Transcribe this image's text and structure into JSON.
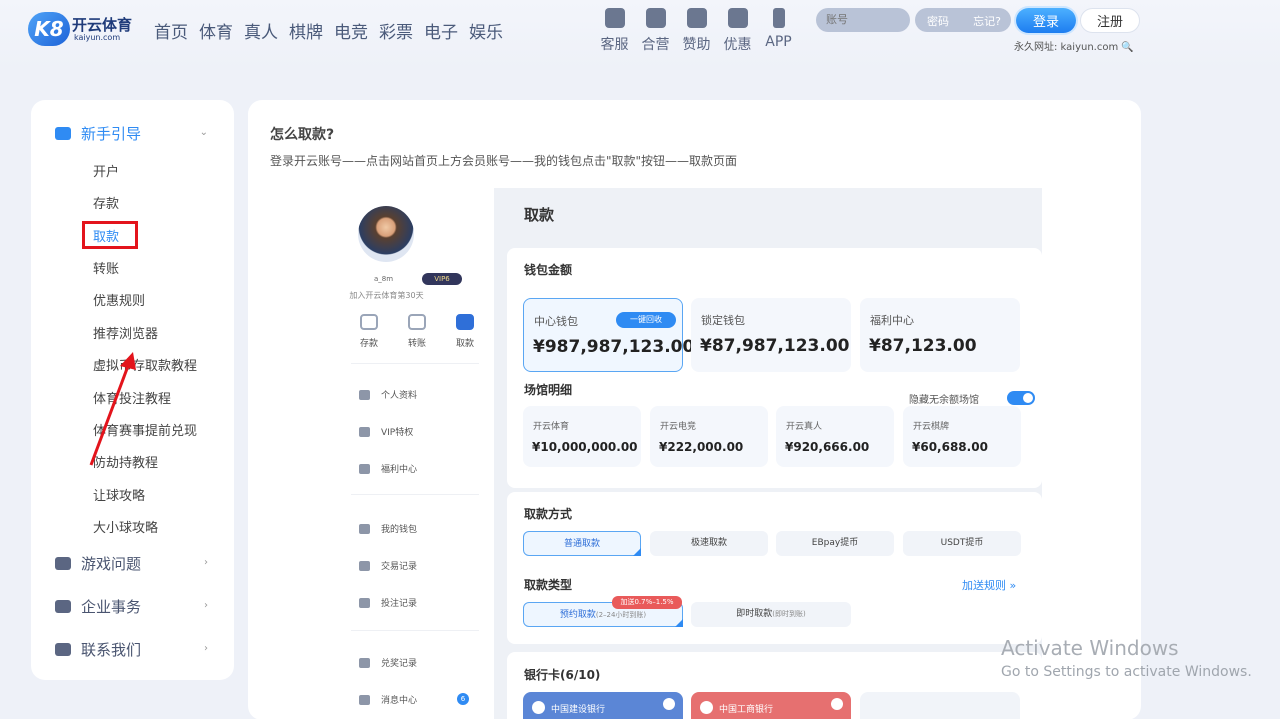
{
  "brand": {
    "logo_mark": "K8",
    "name_cn": "开云体育",
    "name_en": "kaiyun.com"
  },
  "nav": [
    "首页",
    "体育",
    "真人",
    "棋牌",
    "电竞",
    "彩票",
    "电子",
    "娱乐"
  ],
  "tools": [
    {
      "label": "客服",
      "icon": "chat-icon"
    },
    {
      "label": "合营",
      "icon": "partner-icon"
    },
    {
      "label": "赞助",
      "icon": "sponsor-icon"
    },
    {
      "label": "优惠",
      "icon": "gift-icon"
    },
    {
      "label": "APP",
      "icon": "phone-icon"
    }
  ],
  "auth": {
    "account_placeholder": "账号",
    "password_placeholder": "密码",
    "forgot": "忘记?",
    "login": "登录",
    "register": "注册",
    "permanent_url": "永久网址: kaiyun.com"
  },
  "sidebar": {
    "sections": [
      {
        "label": "新手引导",
        "icon": "graduation-cap-icon"
      },
      {
        "label": "游戏问题",
        "icon": "gamepad-icon"
      },
      {
        "label": "企业事务",
        "icon": "building-icon"
      },
      {
        "label": "联系我们",
        "icon": "message-icon"
      }
    ],
    "items": [
      "开户",
      "存款",
      "取款",
      "转账",
      "优惠规则",
      "推荐浏览器",
      "虚拟币存取款教程",
      "体育投注教程",
      "体育赛事提前兑现",
      "防劫持教程",
      "让球攻略",
      "大小球攻略"
    ],
    "active_item": "取款"
  },
  "main": {
    "title": "怎么取款?",
    "description": "登录开云账号——点击网站首页上方会员账号——我的钱包点击\"取款\"按钮——取款页面"
  },
  "profile": {
    "username": "a_8m",
    "vip": "VIP6",
    "joined": "加入开云体育第30天",
    "quick": [
      {
        "label": "存款",
        "icon": "deposit-icon"
      },
      {
        "label": "转账",
        "icon": "transfer-icon"
      },
      {
        "label": "取款",
        "icon": "withdraw-icon"
      }
    ],
    "menu": [
      {
        "label": "个人资料",
        "icon": "id-card-icon"
      },
      {
        "label": "VIP特权",
        "icon": "diamond-icon"
      },
      {
        "label": "福利中心",
        "icon": "gift-icon"
      },
      {
        "label": "我的钱包",
        "icon": "wallet-icon"
      },
      {
        "label": "交易记录",
        "icon": "transaction-icon"
      },
      {
        "label": "投注记录",
        "icon": "bet-record-icon"
      },
      {
        "label": "兑奖记录",
        "icon": "redeem-icon"
      },
      {
        "label": "消息中心",
        "icon": "bell-icon"
      }
    ],
    "message_count": "6"
  },
  "withdraw": {
    "title": "取款",
    "wallet_title": "钱包金额",
    "wallets": [
      {
        "label": "中心钱包",
        "value": "¥987,987,123.00"
      },
      {
        "label": "锁定钱包",
        "value": "¥87,987,123.00"
      },
      {
        "label": "福利中心",
        "value": "¥87,123.00"
      }
    ],
    "recall": "一键回收",
    "venue_title": "场馆明细",
    "hide_empty": "隐藏无余额场馆",
    "venues": [
      {
        "label": "开云体育",
        "value": "¥10,000,000.00"
      },
      {
        "label": "开云电竞",
        "value": "¥222,000.00"
      },
      {
        "label": "开云真人",
        "value": "¥920,666.00"
      },
      {
        "label": "开云棋牌",
        "value": "¥60,688.00"
      }
    ],
    "method_title": "取款方式",
    "methods": [
      "普通取款",
      "极速取款",
      "EBpay提币",
      "USDT提币"
    ],
    "type_title": "取款类型",
    "types": [
      {
        "label": "预约取款",
        "note": "(2–24小时到账)"
      },
      {
        "label": "即时取款",
        "note": "(即时到账)"
      }
    ],
    "bonus": "加送0.7%–1.5%",
    "rules": "加送规则 »",
    "bank_title": "银行卡(6/10)",
    "banks": [
      "中国建设银行",
      "中国工商银行"
    ]
  },
  "colors": {
    "accent": "#2f8bf3",
    "highlight": "#e3141c",
    "page_bg": "#eef1f8"
  },
  "watermark": {
    "line1": "Activate Windows",
    "line2": "Go to Settings to activate Windows."
  }
}
